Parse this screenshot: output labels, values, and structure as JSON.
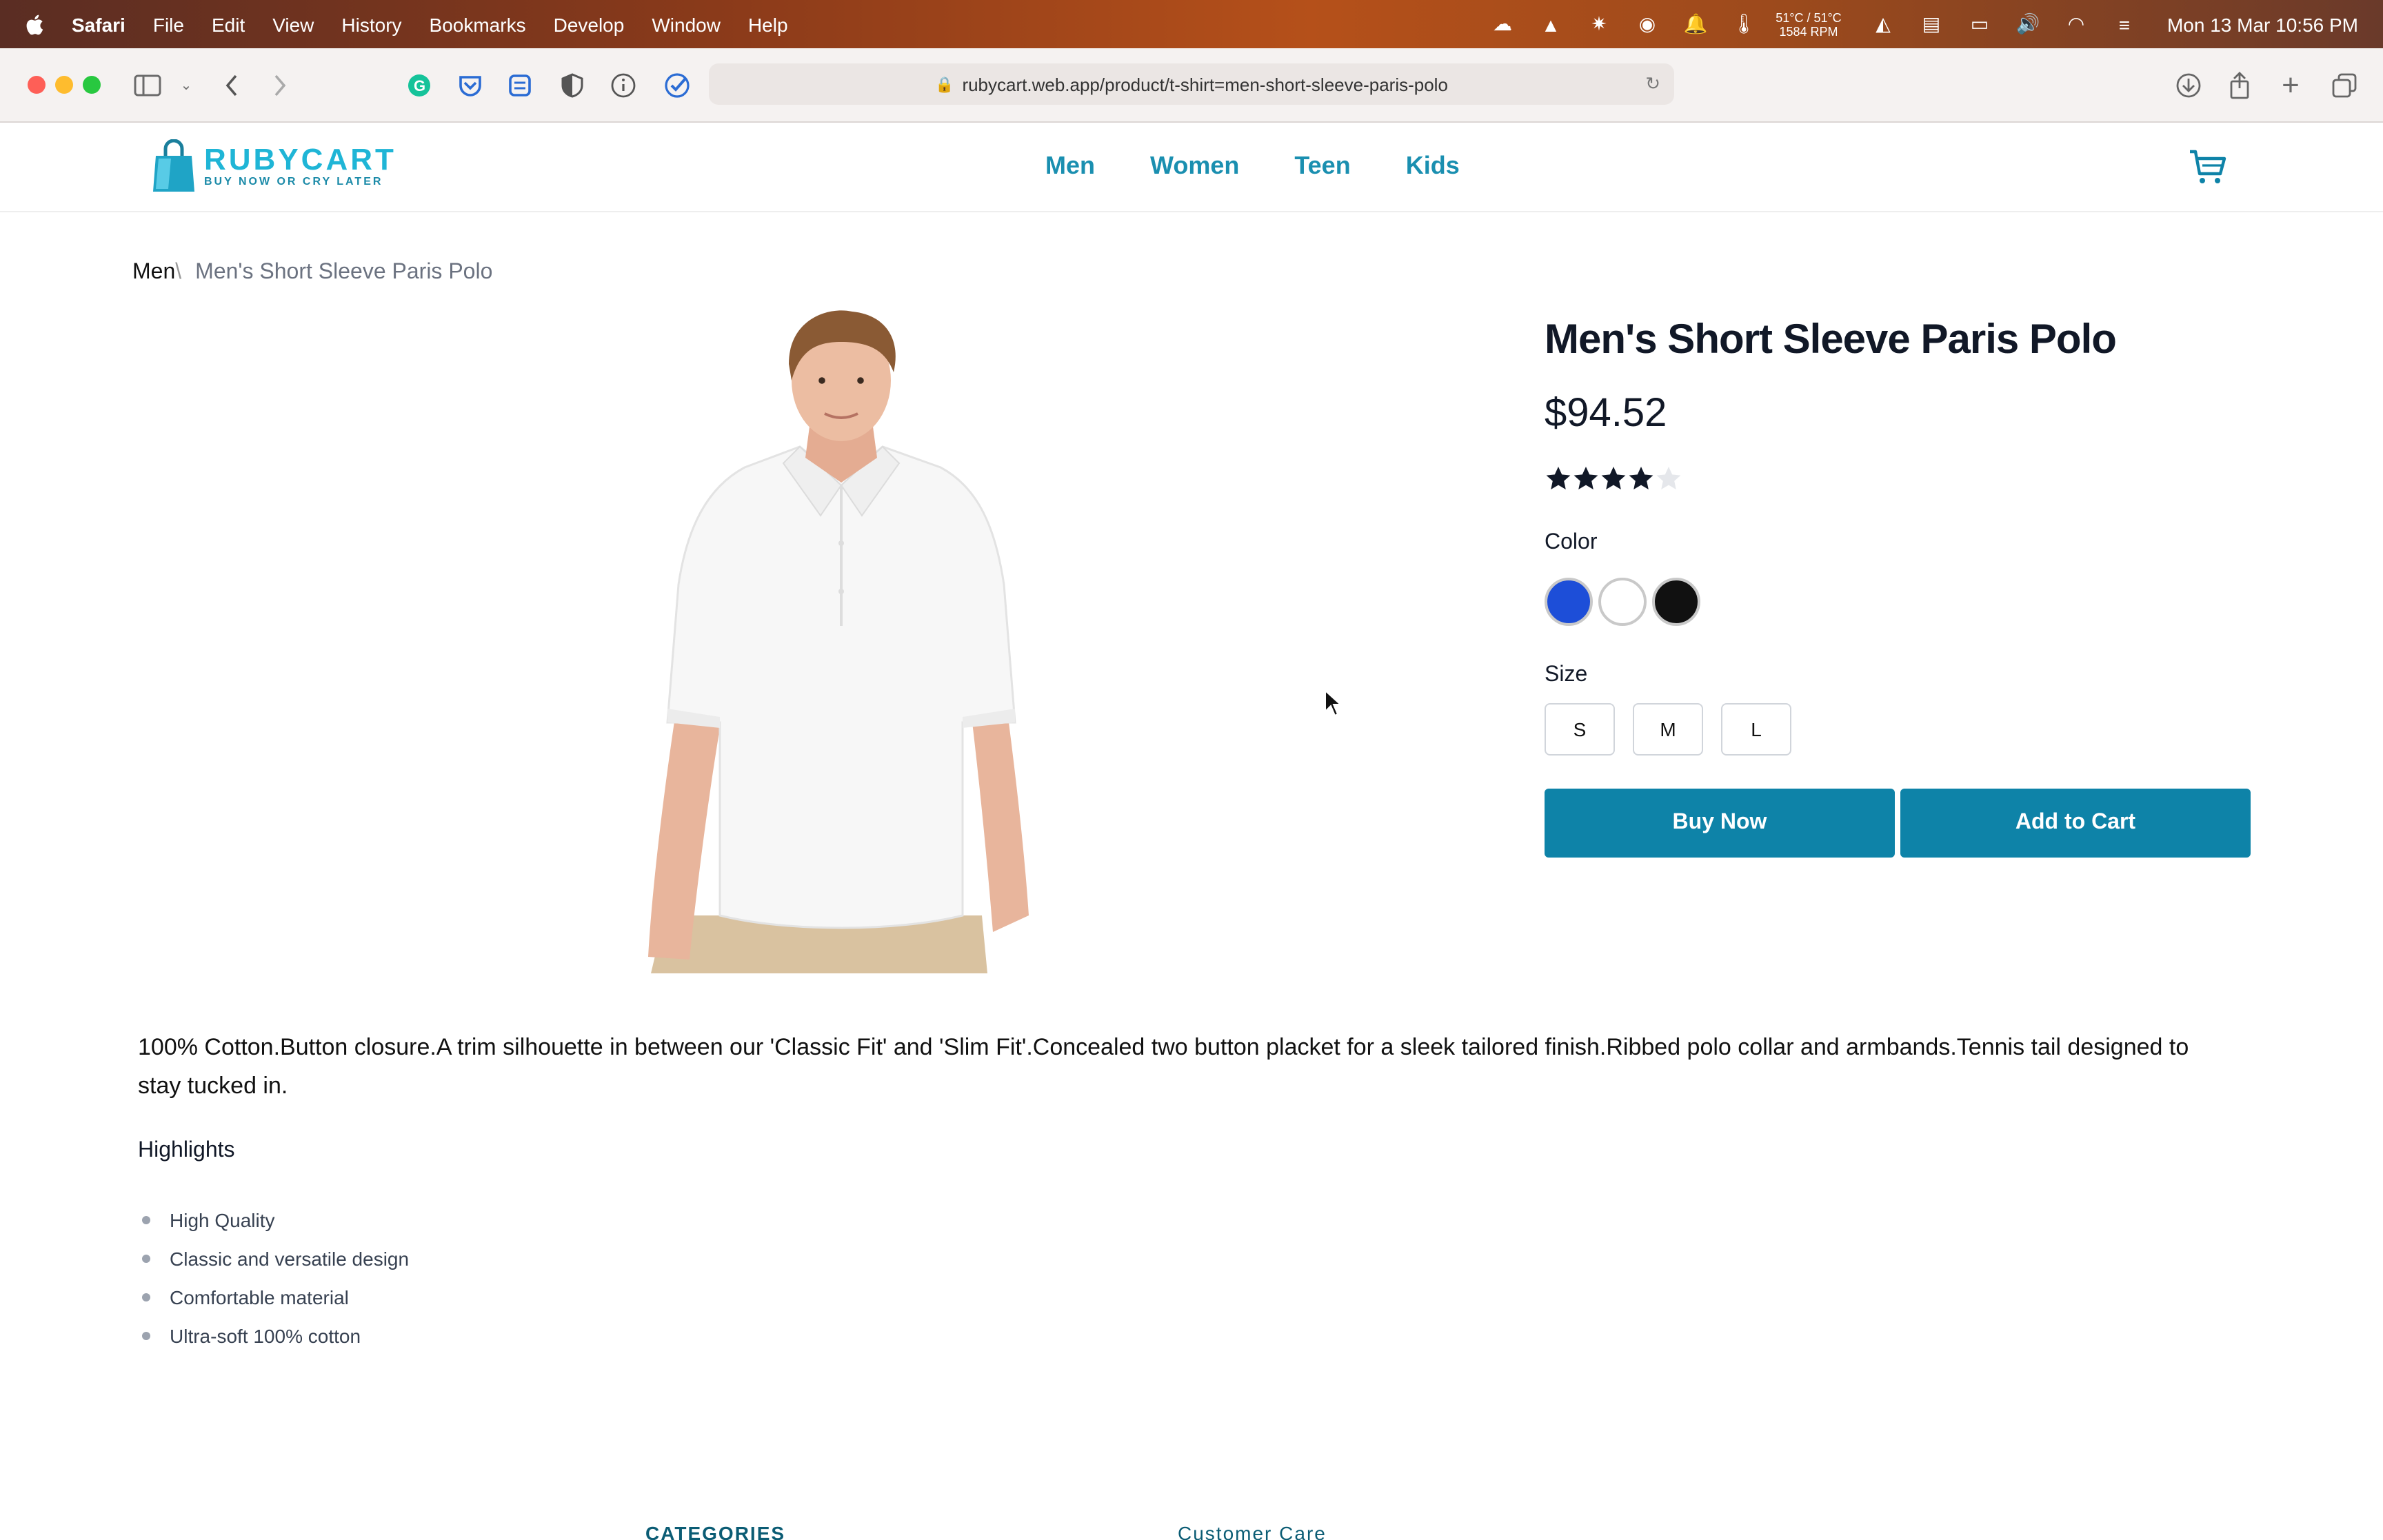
{
  "menubar": {
    "app": "Safari",
    "items": [
      "File",
      "Edit",
      "View",
      "History",
      "Bookmarks",
      "Develop",
      "Window",
      "Help"
    ],
    "temp_line1": "51°C / 51°C",
    "temp_line2": "1584 RPM",
    "clock": "Mon 13 Mar  10:56 PM"
  },
  "browser": {
    "url": "rubycart.web.app/product/t-shirt=men-short-sleeve-paris-polo"
  },
  "site": {
    "logo_name": "RUBYCART",
    "logo_tagline": "BUY NOW OR CRY LATER",
    "nav": [
      "Men",
      "Women",
      "Teen",
      "Kids"
    ]
  },
  "breadcrumb": {
    "home": "Men",
    "separator": "\\",
    "current": "Men's Short Sleeve Paris Polo"
  },
  "product": {
    "title": "Men's Short Sleeve Paris Polo",
    "price": "$94.52",
    "rating": 4,
    "rating_max": 5,
    "color_label": "Color",
    "colors": [
      "#1d4ed8",
      "#ffffff",
      "#111111"
    ],
    "size_label": "Size",
    "sizes": [
      "S",
      "M",
      "L"
    ],
    "buy_label": "Buy Now",
    "cart_label": "Add to Cart",
    "description": "100% Cotton.Button closure.A trim silhouette in between our 'Classic Fit' and 'Slim Fit'.Concealed two button placket for a sleek tailored finish.Ribbed polo collar and armbands.Tennis tail designed to stay tucked in.",
    "highlights_title": "Highlights",
    "highlights": [
      "High Quality",
      "Classic and versatile design",
      "Comfortable material",
      "Ultra-soft 100% cotton"
    ]
  },
  "footer": {
    "categories": "CATEGORIES",
    "customer_care": "Customer Care"
  },
  "colors": {
    "accent": "#0e83a8",
    "nav_link": "#1a8fb0",
    "logo": "#1fb5d6"
  }
}
